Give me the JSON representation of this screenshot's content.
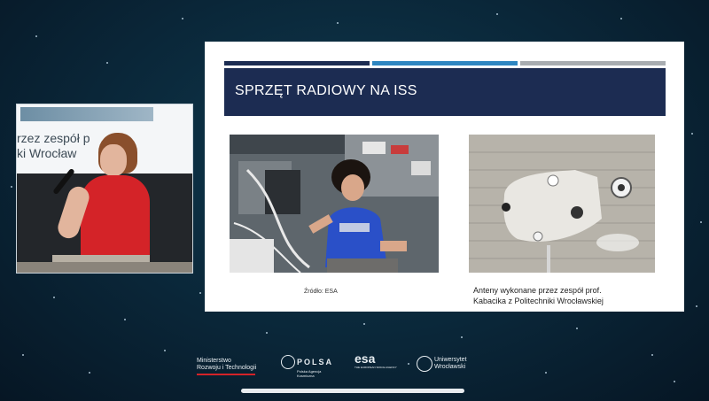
{
  "presenter": {
    "slide_text": "rzez zespół p\nki Wrocław"
  },
  "slide": {
    "title": "SPRZĘT RADIOWY NA ISS",
    "stripe_colors": [
      "#1c2c52",
      "#2e86c1",
      "#a9adb1"
    ],
    "left_caption": "Źródło: ESA",
    "right_caption_line1": "Anteny wykonane przez zespół prof.",
    "right_caption_line2": "Kabacika z Politechniki Wrocławskiej"
  },
  "logos": {
    "ministry_line1": "Ministerstwo",
    "ministry_line2": "Rozwoju i Technologii",
    "polsa": "POLSA",
    "polsa_sub_line1": "Polska Agencja",
    "polsa_sub_line2": "Kosmiczna",
    "esa": "esa",
    "esa_sub": "THE EUROPEAN SPACE AGENCY",
    "university_line1": "Uniwersytet",
    "university_line2": "Wrocławski"
  }
}
